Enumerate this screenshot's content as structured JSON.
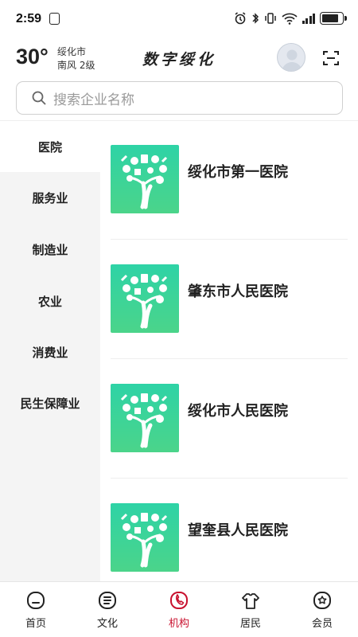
{
  "status_bar": {
    "time": "2:59",
    "icons": [
      "nfc-icon",
      "alarm-icon",
      "bluetooth-icon",
      "vibrate-icon",
      "wifi-icon",
      "signal-icon",
      "battery-icon"
    ]
  },
  "header": {
    "temperature": "30°",
    "city": "绥化市",
    "wind": "南风 2级",
    "title": "数字绥化"
  },
  "search": {
    "placeholder": "搜索企业名称"
  },
  "sidebar": {
    "items": [
      {
        "label": "医院",
        "active": true
      },
      {
        "label": "服务业",
        "active": false
      },
      {
        "label": "制造业",
        "active": false
      },
      {
        "label": "农业",
        "active": false
      },
      {
        "label": "消费业",
        "active": false
      },
      {
        "label": "民生保障业",
        "active": false
      }
    ]
  },
  "orgs": [
    {
      "name": "绥化市第一医院"
    },
    {
      "name": "肇东市人民医院"
    },
    {
      "name": "绥化市人民医院"
    },
    {
      "name": "望奎县人民医院"
    }
  ],
  "bottom_nav": {
    "items": [
      {
        "label": "首页",
        "icon": "home-icon",
        "active": false
      },
      {
        "label": "文化",
        "icon": "culture-icon",
        "active": false
      },
      {
        "label": "机构",
        "icon": "institution-icon",
        "active": true
      },
      {
        "label": "居民",
        "icon": "resident-icon",
        "active": false
      },
      {
        "label": "会员",
        "icon": "member-icon",
        "active": false
      }
    ]
  },
  "colors": {
    "accent": "#c8102e",
    "thumb_top": "#2ed3a6",
    "thumb_bottom": "#4bd48a"
  }
}
